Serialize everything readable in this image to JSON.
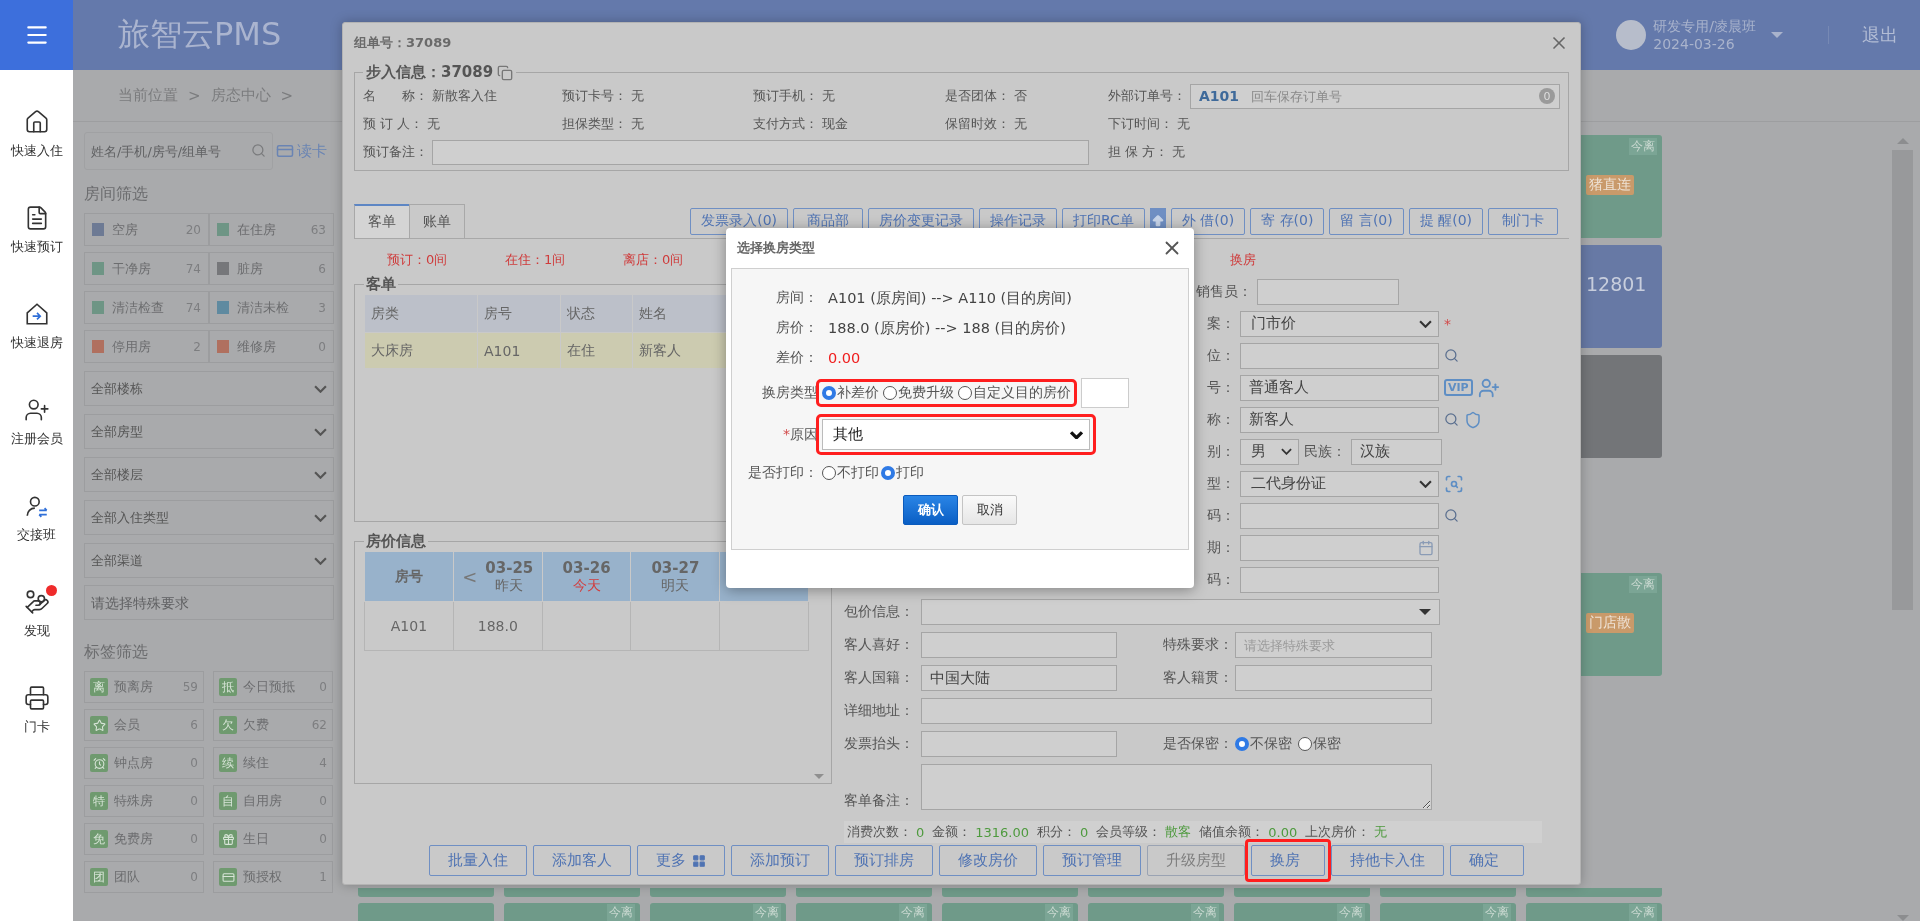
{
  "nav": {
    "items": [
      {
        "label": "快速入住",
        "dot": false
      },
      {
        "label": "快速预订",
        "dot": false
      },
      {
        "label": "快速退房",
        "dot": false
      },
      {
        "label": "注册会员",
        "dot": false
      },
      {
        "label": "交接班",
        "dot": false
      },
      {
        "label": "发现",
        "dot": true
      },
      {
        "label": "门卡",
        "dot": false
      }
    ]
  },
  "header": {
    "title": "旅智云PMS",
    "user": "研发专用/凌晨班",
    "date": "2024-03-26",
    "logout": "退出"
  },
  "breadcrumb": [
    "当前位置",
    ">",
    "房态中心",
    ">"
  ],
  "filters": {
    "search_placeholder": "姓名/手机/房号/组单号",
    "read_card": "读卡",
    "room_heading": "房间筛选",
    "room_status": [
      {
        "label": "空房",
        "count": "20",
        "color": "#6d7a94"
      },
      {
        "label": "在住房",
        "count": "63",
        "color": "#6e9585"
      },
      {
        "label": "干净房",
        "count": "74",
        "color": "#6e9585"
      },
      {
        "label": "脏房",
        "count": "6",
        "color": "#76777a"
      },
      {
        "label": "清洁检查",
        "count": "74",
        "color": "#6e9585"
      },
      {
        "label": "清洁未检",
        "count": "3",
        "color": "#5f8aa0"
      },
      {
        "label": "停用房",
        "count": "2",
        "color": "#b0705f"
      },
      {
        "label": "维修房",
        "count": "0",
        "color": "#b0705f"
      }
    ],
    "dropdowns": [
      "全部楼栋",
      "全部房型",
      "全部楼层",
      "全部入住类型",
      "全部渠道"
    ],
    "special_placeholder": "请选择特殊要求",
    "tag_heading": "标签筛选",
    "tags": [
      {
        "kind": "letter",
        "badge": "离",
        "label": "预离房",
        "count": "59"
      },
      {
        "kind": "letter",
        "badge": "抵",
        "label": "今日预抵",
        "count": "0"
      },
      {
        "kind": "icon",
        "label": "会员",
        "count": "6"
      },
      {
        "kind": "letter",
        "badge": "欠",
        "label": "欠费",
        "count": "62"
      },
      {
        "kind": "icon",
        "label": "钟点房",
        "count": "0"
      },
      {
        "kind": "letter",
        "badge": "续",
        "label": "续住",
        "count": "4"
      },
      {
        "kind": "letter",
        "badge": "特",
        "label": "特殊房",
        "count": "0"
      },
      {
        "kind": "letter",
        "badge": "自",
        "label": "自用房",
        "count": "0"
      },
      {
        "kind": "letter",
        "badge": "免",
        "label": "免费房",
        "count": "0"
      },
      {
        "kind": "icon",
        "label": "生日",
        "count": "0"
      },
      {
        "kind": "letter",
        "badge": "团",
        "label": "团队",
        "count": "0"
      },
      {
        "kind": "icon",
        "label": "预授权",
        "count": "1"
      }
    ]
  },
  "room_cards": [
    {
      "color": "#6f9a89",
      "badge": "今离",
      "tag": "猪直连"
    },
    {
      "color": "#6779a5",
      "number": "12801"
    },
    {
      "color": "#737578"
    },
    {
      "color": "#6f9a89",
      "badge": "今离",
      "tag": "门店散"
    }
  ],
  "bottom_cards": [
    {
      "kind": "plain"
    },
    {
      "kind": "badge",
      "badge": "今离"
    },
    {
      "kind": "badge",
      "badge": "今离"
    },
    {
      "kind": "badge",
      "badge": "今离"
    },
    {
      "kind": "badge",
      "badge": "今离"
    },
    {
      "kind": "badge",
      "badge": "今离"
    },
    {
      "kind": "badge",
      "badge": "今离"
    },
    {
      "kind": "badge",
      "badge": "今离"
    },
    {
      "kind": "badge",
      "badge": "今离"
    }
  ],
  "group_dialog": {
    "title": "组单号：37089",
    "legend": "步入信息：37089",
    "info_rows": [
      [
        {
          "kind": "text",
          "label": "名　　称：",
          "value": "新散客入住"
        },
        {
          "kind": "text",
          "label": "预订卡号：",
          "value": "无"
        },
        {
          "kind": "text",
          "label": "预订手机：",
          "value": "无"
        },
        {
          "kind": "text",
          "label": "是否团体：",
          "value": "否"
        },
        {
          "kind": "order",
          "label": "外部订单号：",
          "value": "A101",
          "placeholder": "回车保存订单号",
          "count": "0"
        }
      ],
      [
        {
          "kind": "text",
          "label": "预 订 人：",
          "value": "无"
        },
        {
          "kind": "text",
          "label": "担保类型：",
          "value": "无"
        },
        {
          "kind": "text",
          "label": "支付方式：",
          "value": "现金"
        },
        {
          "kind": "text",
          "label": "保留时效：",
          "value": "无"
        },
        {
          "kind": "text",
          "label": "下订时间：",
          "value": "无"
        }
      ],
      [
        {
          "kind": "field",
          "label": "预订备注："
        },
        {
          "kind": "text",
          "label": "担 保 方：",
          "value": "无"
        }
      ]
    ],
    "tabs": [
      {
        "label": "客单",
        "selected": true
      },
      {
        "label": "账单",
        "selected": false
      }
    ],
    "toolbar": [
      {
        "kind": "button",
        "label": "发票录入(0)"
      },
      {
        "kind": "button",
        "label": "商品部"
      },
      {
        "kind": "button",
        "label": "房价变更记录"
      },
      {
        "kind": "button",
        "label": "操作记录"
      },
      {
        "kind": "button",
        "label": "打印RC单"
      },
      {
        "kind": "arrow"
      },
      {
        "kind": "button",
        "label": "外 借(0)"
      },
      {
        "kind": "button",
        "label": "寄 存(0)"
      },
      {
        "kind": "button",
        "label": "留 言(0)"
      },
      {
        "kind": "button",
        "label": "提 醒(0)"
      },
      {
        "kind": "button",
        "label": "制门卡"
      }
    ],
    "counts": [
      "预订：0间",
      "在住：1间",
      "离店：0间"
    ],
    "status_note": "换房",
    "guest_table": {
      "legend": "客单",
      "columns": [
        "房类",
        "房号",
        "状态",
        "姓名"
      ],
      "rows": [
        {
          "cells": [
            "大床房",
            "A101",
            "在住",
            "新客人"
          ],
          "selected": true
        }
      ]
    },
    "price_table": {
      "legend": "房价信息",
      "room_header": "房号",
      "days": [
        {
          "date": "03-25",
          "day": "昨天",
          "today": false,
          "prev": "<"
        },
        {
          "date": "03-26",
          "day": "今天",
          "today": true
        },
        {
          "date": "03-27",
          "day": "明天",
          "today": false
        }
      ],
      "rows": [
        {
          "room": "A101",
          "prices": [
            "188.0"
          ]
        }
      ]
    },
    "upper_rows": [
      {
        "kind": "field",
        "label": "销售员："
      },
      {
        "kind": "select",
        "label": "案：",
        "value": "门市价",
        "mark": "*"
      },
      {
        "kind": "field",
        "label": "位："
      },
      {
        "kind": "field",
        "label": "号：",
        "value": "普通客人",
        "badge": "VIP"
      },
      {
        "kind": "field",
        "label": "称：",
        "value": "新客人"
      },
      {
        "kind": "gender",
        "label": "别：",
        "value": "男",
        "label2": "民族：",
        "value2": "汉族"
      },
      {
        "kind": "select",
        "label": "型：",
        "value": "二代身份证"
      },
      {
        "kind": "field",
        "label": "码："
      },
      {
        "kind": "date",
        "label": "期："
      },
      {
        "kind": "field",
        "label": "码："
      }
    ],
    "lower_rows": [
      {
        "kind": "select",
        "label": "包价信息："
      },
      {
        "kind": "pair",
        "left": {
          "label": "客人喜好："
        },
        "right": {
          "label": "特殊要求：",
          "placeholder": "请选择特殊要求"
        }
      },
      {
        "kind": "pair",
        "left": {
          "label": "客人国籍：",
          "value": "中国大陆"
        },
        "right": {
          "label": "客人籍贯："
        }
      },
      {
        "kind": "wide",
        "label": "详细地址："
      },
      {
        "kind": "pair",
        "left": {
          "label": "发票抬头："
        },
        "right": {
          "label": "是否保密：",
          "options": [
            {
              "label": "不保密",
              "selected": true
            },
            {
              "label": "保密",
              "selected": false
            }
          ]
        }
      },
      {
        "kind": "textarea",
        "label": "客单备注："
      }
    ],
    "summary": [
      {
        "label": "消费次数：",
        "value": "0"
      },
      {
        "label": "金额：",
        "value": "1316.00"
      },
      {
        "label": "积分：",
        "value": "0"
      },
      {
        "label": "会员等级：",
        "value": "散客"
      },
      {
        "label": "储值余额：",
        "value": "0.00"
      },
      {
        "label": "上次房价：",
        "value": "无"
      }
    ],
    "buttons": [
      {
        "kind": "plain",
        "label": "批量入住",
        "disabled": false,
        "highlighted": false
      },
      {
        "kind": "plain",
        "label": "添加客人",
        "disabled": false,
        "highlighted": false
      },
      {
        "kind": "more",
        "label": "更多",
        "disabled": false,
        "highlighted": false
      },
      {
        "kind": "plain",
        "label": "添加预订",
        "disabled": false,
        "highlighted": false
      },
      {
        "kind": "plain",
        "label": "预订排房",
        "disabled": false,
        "highlighted": false
      },
      {
        "kind": "plain",
        "label": "修改房价",
        "disabled": false,
        "highlighted": false
      },
      {
        "kind": "plain",
        "label": "预订管理",
        "disabled": false,
        "highlighted": false
      },
      {
        "kind": "plain",
        "label": "升级房型",
        "disabled": true,
        "highlighted": false
      },
      {
        "kind": "plain",
        "label": "换房",
        "disabled": false,
        "highlighted": true
      },
      {
        "kind": "plain",
        "label": "持他卡入住",
        "disabled": false,
        "highlighted": false
      },
      {
        "kind": "plain",
        "label": "确定",
        "disabled": false,
        "highlighted": false
      }
    ]
  },
  "swap_dialog": {
    "title": "选择换房类型",
    "lines": [
      {
        "kind": "plain",
        "label": "房间：",
        "value": "A101 (原房间) --> A110 (目的房间)"
      },
      {
        "kind": "plain",
        "label": "房价：",
        "value": "188.0 (原房价) --> 188 (目的房价)"
      },
      {
        "kind": "diff",
        "label": "差价：",
        "value": "0.00"
      }
    ],
    "swap_type": {
      "label": "换房类型",
      "highlighted": true,
      "options": [
        {
          "label": "补差价",
          "selected": true
        },
        {
          "label": "免费升级",
          "selected": false
        },
        {
          "label": "自定义目的房价",
          "selected": false
        }
      ]
    },
    "reason": {
      "label": "原因",
      "mark": "*",
      "value": "其他",
      "highlighted": true
    },
    "print": {
      "label": "是否打印：",
      "options": [
        {
          "label": "不打印",
          "selected": false
        },
        {
          "label": "打印",
          "selected": true
        }
      ]
    },
    "buttons": [
      {
        "label": "确认",
        "primary": true
      },
      {
        "label": "取消",
        "primary": false
      }
    ]
  }
}
